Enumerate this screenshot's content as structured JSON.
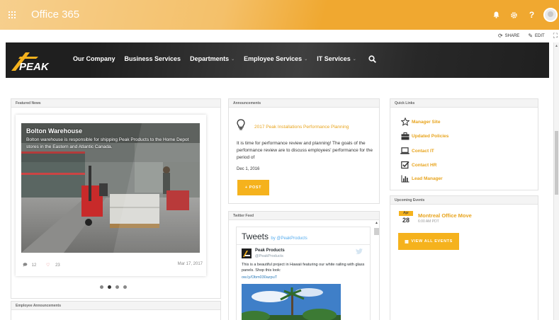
{
  "suite_bar": {
    "title": "Office 365",
    "icons": [
      "bell-icon",
      "gear-icon",
      "help-icon",
      "avatar"
    ],
    "help_label": "?",
    "accent_color": "#f0a830"
  },
  "action_bar": {
    "share_label": "SHARE",
    "edit_label": "EDIT"
  },
  "header": {
    "logo_text": "PEAK",
    "nav": [
      {
        "label": "Our Company",
        "has_dropdown": false
      },
      {
        "label": "Business Services",
        "has_dropdown": false
      },
      {
        "label": "Departments",
        "has_dropdown": true
      },
      {
        "label": "Employee Services",
        "has_dropdown": true
      },
      {
        "label": "IT Services",
        "has_dropdown": true
      }
    ]
  },
  "featured_news": {
    "heading": "Featured News",
    "title": "Bolton Warehouse",
    "text": "Bolton warehouse is responsible for shipping Peak Products to the Home Depot stores in the Eastern and Atlantic Canada.",
    "comments": "12",
    "likes": "23",
    "date": "Mar 17, 2017",
    "slides": 4,
    "active_slide": 2
  },
  "employee_announcements": {
    "heading": "Employee Announcements"
  },
  "announcements": {
    "heading": "Announcements",
    "title": "2017 Peak Installations Performance Planning",
    "body": "It is time for performance review and planning! The goals of the performance review are to discuss employees' performance for the period of",
    "date": "Dec 1, 2016",
    "post_button": "+ POST"
  },
  "twitter_feed": {
    "heading": "Twitter Feed",
    "tweets_label": "Tweets",
    "by_label": "by @PeakProducts",
    "account_name": "Peak Products",
    "account_handle": "@PeakProducts",
    "tweet_text": "This is a beautiful project in Hawaii featuring our white railing with glass panels. Shop this look:",
    "tweet_link": "ow.ly/Obm030azpuT"
  },
  "quick_links": {
    "heading": "Quick Links",
    "items": [
      {
        "label": "Manager Site",
        "icon": "star-icon"
      },
      {
        "label": "Updated Policies",
        "icon": "briefcase-icon"
      },
      {
        "label": "Contact IT",
        "icon": "laptop-icon"
      },
      {
        "label": "Contact HR",
        "icon": "checkbox-icon"
      },
      {
        "label": "Lead Manager",
        "icon": "bar-chart-icon"
      }
    ]
  },
  "upcoming_events": {
    "heading": "Upcoming Events",
    "month": "Apr",
    "day": "28",
    "title": "Montreal Office Move",
    "time": "6:00 AM PDT",
    "button": "VIEW ALL EVENTS"
  }
}
